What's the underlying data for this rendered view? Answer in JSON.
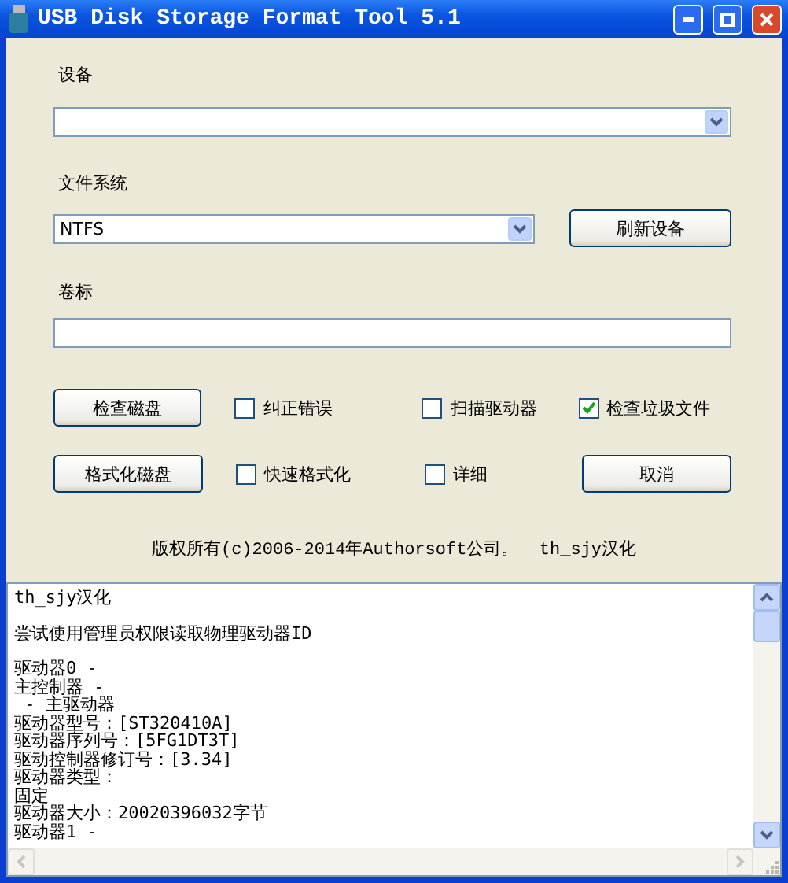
{
  "window": {
    "title": "USB Disk Storage Format Tool 5.1"
  },
  "device": {
    "label": "设备"
  },
  "file_system": {
    "label": "文件系统",
    "value": "NTFS"
  },
  "refresh_button": "刷新设备",
  "volume_label": {
    "label": "卷标"
  },
  "rows": [
    {
      "button": "检查磁盘",
      "options": [
        {
          "label": "纠正错误",
          "checked": false
        },
        {
          "label": "扫描驱动器",
          "checked": false
        },
        {
          "label": "检查垃圾文件",
          "checked": true
        }
      ]
    },
    {
      "button": "格式化磁盘",
      "options": [
        {
          "label": "快速格式化",
          "checked": false
        },
        {
          "label": "详细",
          "checked": false
        }
      ],
      "cancel": "取消"
    }
  ],
  "copyright": "版权所有(c)2006-2014年Authorsoft公司。  th_sjy汉化",
  "log": [
    [
      "th_sjy汉化"
    ],
    [
      "尝试使用管理员权限读取物理驱动器ID"
    ],
    [
      "驱动器0 -",
      "主控制器 -",
      " - 主驱动器",
      "驱动器型号：[ST320410A]",
      "驱动器序列号：[5FG1DT3T]",
      "驱动控制器修订号：[3.34]",
      "驱动器类型：",
      "固定",
      "驱动器大小：20020396032字节",
      "驱动器1 -"
    ]
  ]
}
